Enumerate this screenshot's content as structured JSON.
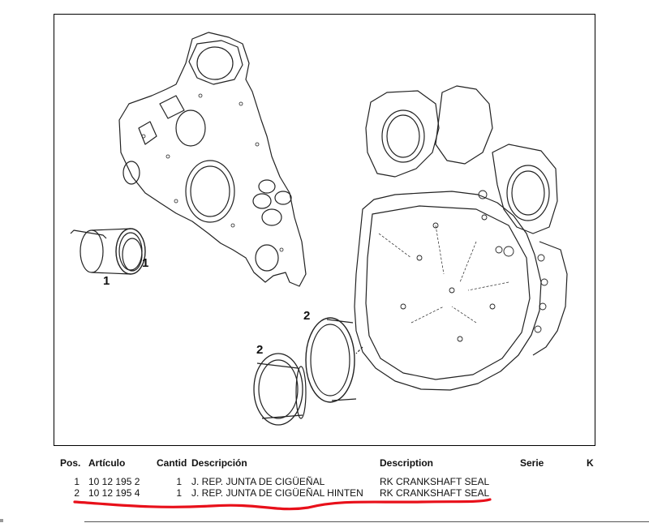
{
  "callouts": {
    "left_front_lower": "1",
    "left_front_upper": "1",
    "right_rear_upper": "2",
    "right_rear_lower": "2"
  },
  "table": {
    "headers": {
      "pos": "Pos.",
      "articulo": "Artículo",
      "cantid": "Cantid",
      "descripcion": "Descripción",
      "description": "Description",
      "serie": "Serie",
      "k": "K"
    },
    "rows": [
      {
        "pos": "1",
        "articulo": "10 12 195 2",
        "cantid": "1",
        "descripcion": "J. REP. JUNTA DE CIGÜEÑAL",
        "description": "RK CRANKSHAFT SEAL",
        "serie": "",
        "k": ""
      },
      {
        "pos": "2",
        "articulo": "10 12 195 4",
        "cantid": "1",
        "descripcion": "J. REP. JUNTA DE CIGÜEÑAL HINTEN",
        "description": "RK CRANKSHAFT SEAL",
        "serie": "",
        "k": ""
      }
    ]
  },
  "colors": {
    "annotation_underline": "#e8101a",
    "line_art": "#222222"
  }
}
